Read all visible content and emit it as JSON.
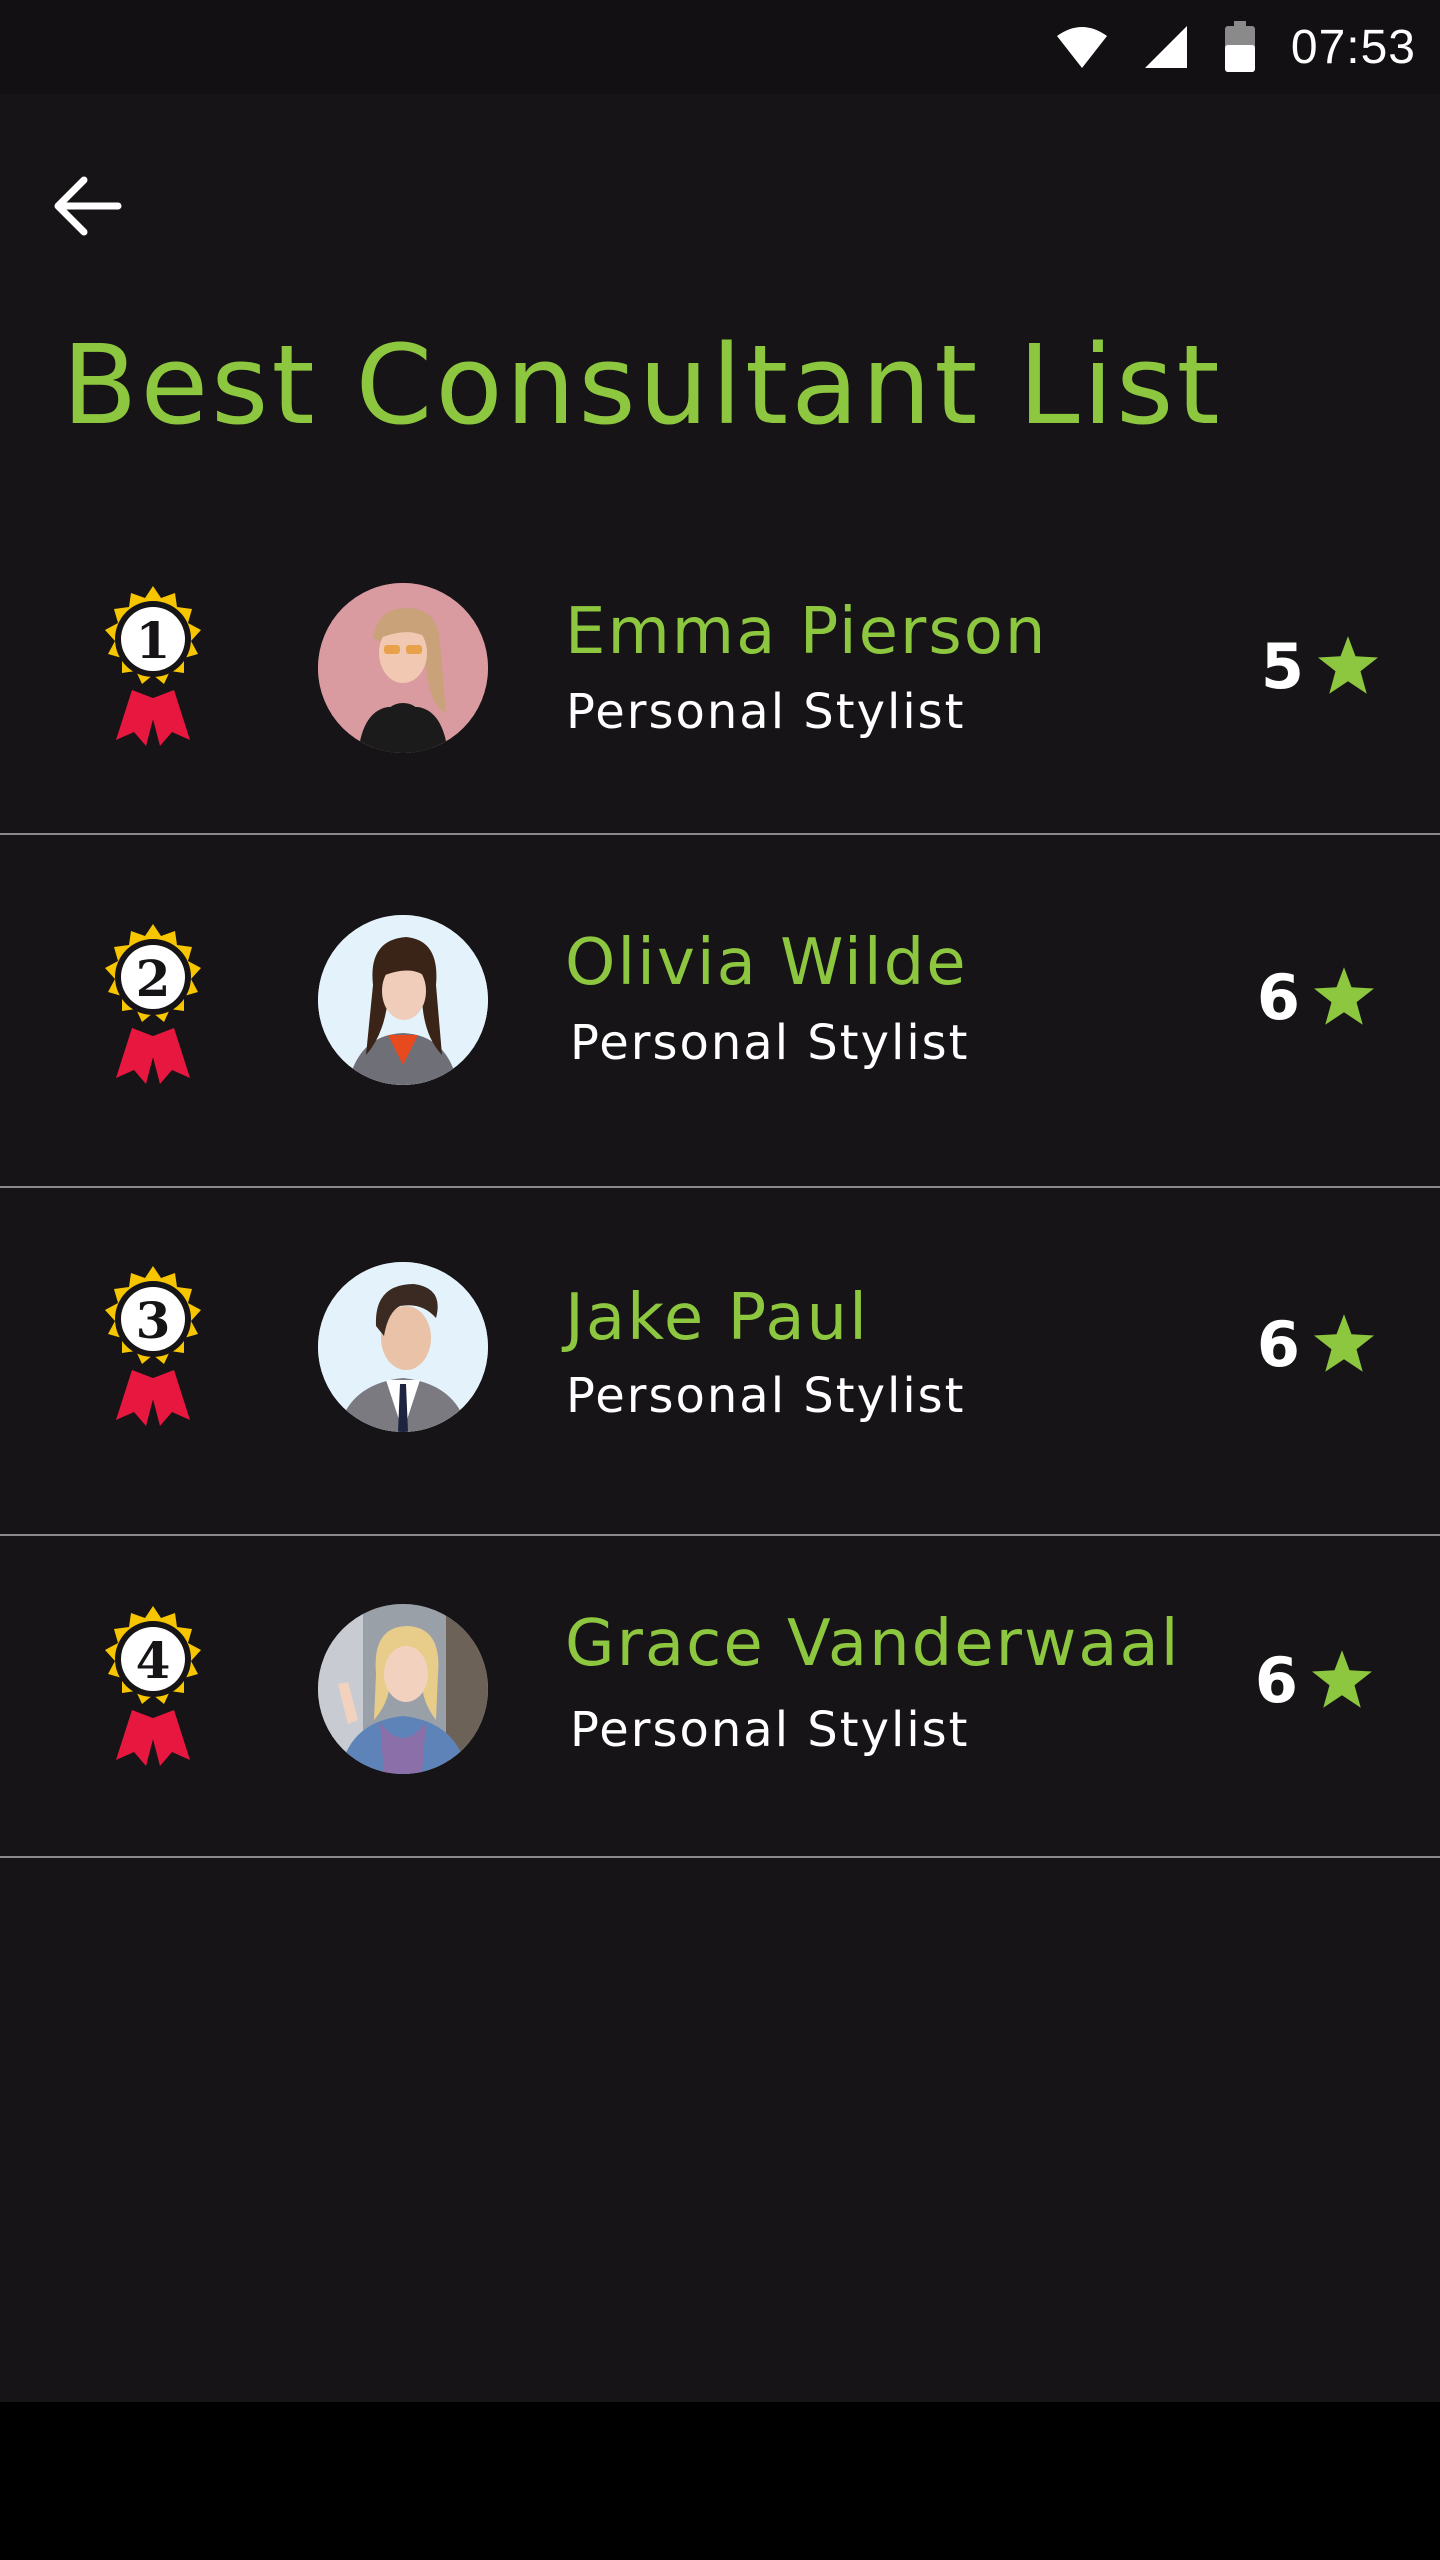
{
  "status_bar": {
    "time": "07:53",
    "icons": [
      "wifi-icon",
      "cell-signal-icon",
      "battery-icon"
    ]
  },
  "header": {
    "back_icon": "arrow-left-icon",
    "title": "Best Consultant List"
  },
  "colors": {
    "background": "#161416",
    "accent": "#8dc63f",
    "medal_gold": "#f7c600",
    "ribbon_red": "#e8173f",
    "divider": "#8a888a"
  },
  "consultants": [
    {
      "rank": "1",
      "name": "Emma Pierson",
      "role": "Personal Stylist",
      "rating": "5"
    },
    {
      "rank": "2",
      "name": "Olivia Wilde",
      "role": "Personal Stylist",
      "rating": "6"
    },
    {
      "rank": "3",
      "name": "Jake Paul",
      "role": "Personal Stylist",
      "rating": "6"
    },
    {
      "rank": "4",
      "name": "Grace Vanderwaal",
      "role": "Personal Stylist",
      "rating": "6"
    }
  ]
}
